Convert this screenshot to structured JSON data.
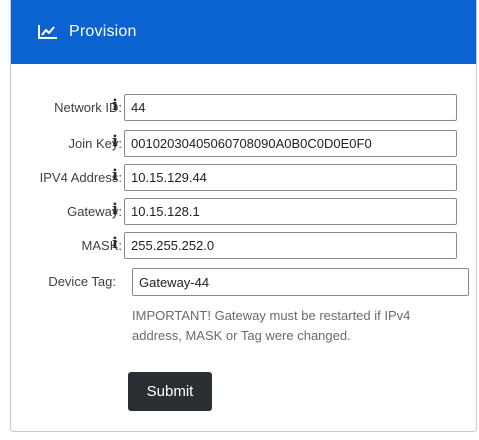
{
  "header": {
    "title": "Provision",
    "icon": "chart-line-icon",
    "background": "#0b62d1"
  },
  "form": {
    "fields": [
      {
        "label": "Network ID:",
        "value": "44",
        "info": "i"
      },
      {
        "label": "Join Key:",
        "value": "00102030405060708090A0B0C0D0E0F0",
        "info": "i"
      },
      {
        "label": "IPV4 Address:",
        "value": "10.15.129.44",
        "info": "i"
      },
      {
        "label": "Gateway:",
        "value": "10.15.128.1",
        "info": "i"
      },
      {
        "label": "MASK:",
        "value": "255.255.252.0",
        "info": "i"
      },
      {
        "label": "Device Tag:",
        "value": "Gateway-44"
      }
    ],
    "note": "IMPORTANT! Gateway must be restarted if IPv4 address, MASK or Tag were changed.",
    "submit_label": "Submit"
  }
}
